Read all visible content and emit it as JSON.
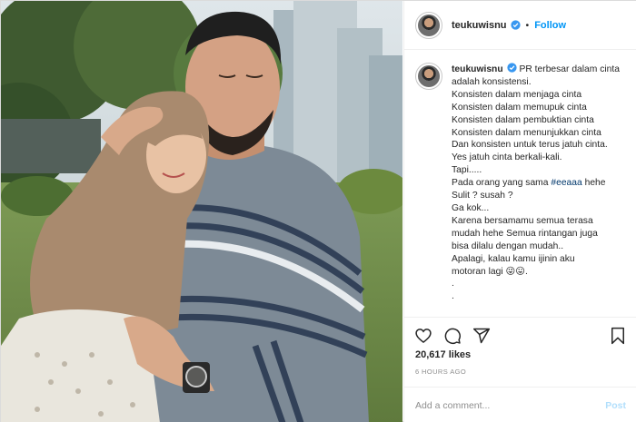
{
  "account": {
    "username": "teukuwisnu",
    "follow_label": "Follow",
    "separator": "•"
  },
  "caption": {
    "username": "teukuwisnu",
    "lines": [
      "PR terbesar dalam cinta",
      "adalah konsistensi.",
      "Konsisten dalam menjaga cinta",
      "Konsisten dalam memupuk cinta",
      "Konsisten dalam pembuktian cinta",
      "Konsisten dalam menunjukkan cinta",
      "Dan konsisten untuk terus jatuh cinta.",
      "Yes jatuh cinta berkali-kali.",
      "Tapi.....",
      "Pada orang yang sama",
      "Sulit ? susah ?",
      "Ga kok...",
      "Karena bersamamu semua terasa",
      "mudah hehe Semua rintangan juga",
      "bisa dilalu dengan mudah..",
      "Apalagi, kalau kamu ijinin aku",
      "motoran lagi",
      ".",
      "."
    ],
    "hashtag": "#eeaaa",
    "after_hashtag": " hehe",
    "emoji": "😜😛."
  },
  "stats": {
    "likes": "20,617 likes",
    "time": "6 HOURS AGO"
  },
  "comment": {
    "placeholder": "Add a comment...",
    "post_label": "Post"
  },
  "icons": {
    "like": "heart-icon",
    "comment": "comment-icon",
    "share": "share-icon",
    "save": "bookmark-icon",
    "verified": "verified-badge-icon"
  },
  "colors": {
    "link_blue": "#0095f6",
    "hashtag": "#00376b",
    "post_disabled": "#b2dffc",
    "muted": "#8e8e8e",
    "text": "#262626"
  }
}
